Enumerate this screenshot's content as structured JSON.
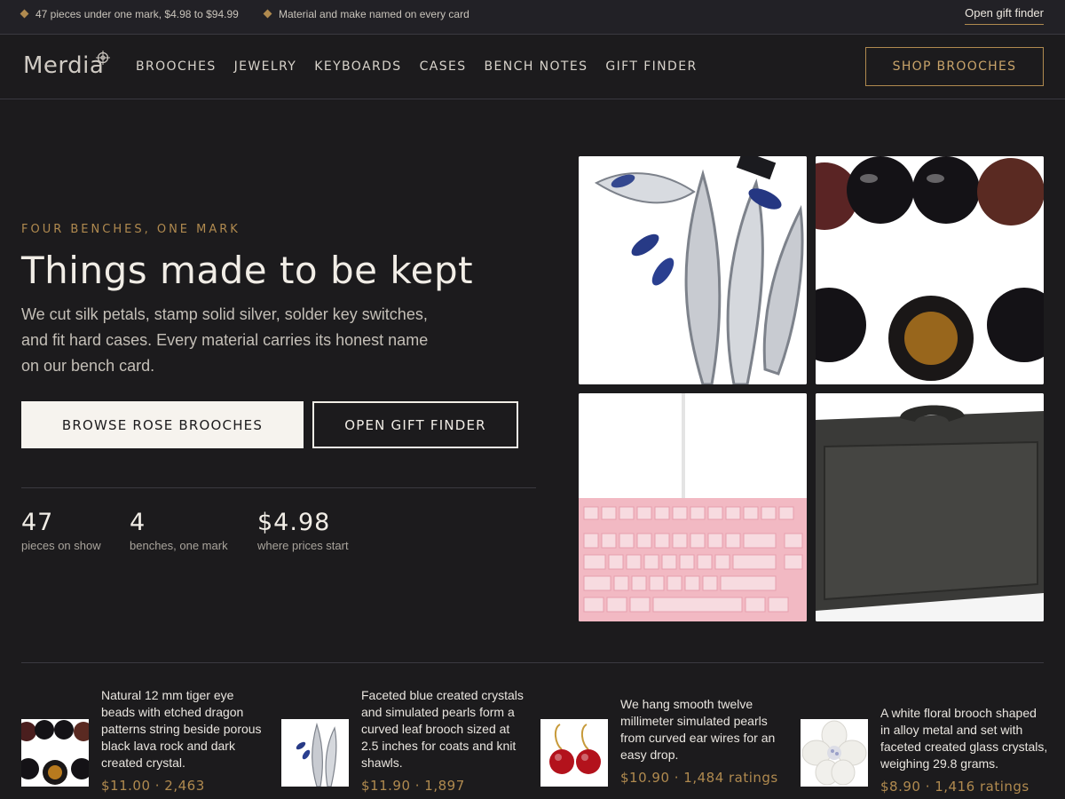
{
  "promo": {
    "items": [
      "47 pieces under one mark, $4.98 to $94.99",
      "Material and make named on every card"
    ],
    "link": "Open gift finder"
  },
  "header": {
    "logo": "Merdia",
    "nav": [
      "BROOCHES",
      "JEWELRY",
      "KEYBOARDS",
      "CASES",
      "BENCH NOTES",
      "GIFT FINDER"
    ],
    "cta": "SHOP BROOCHES"
  },
  "hero": {
    "eyebrow": "FOUR BENCHES, ONE MARK",
    "title": "Things made to be kept",
    "description": "We cut silk petals, stamp solid silver, solder key switches, and fit hard cases. Every material carries its honest name on our bench card.",
    "primary_button": "BROWSE ROSE BROOCHES",
    "secondary_button": "OPEN GIFT FINDER",
    "stats": [
      {
        "value": "47",
        "label": "pieces on show"
      },
      {
        "value": "4",
        "label": "benches, one mark"
      },
      {
        "value": "$4.98",
        "label": "where prices start"
      }
    ]
  },
  "products": [
    {
      "description": "Natural 12 mm tiger eye beads with etched dragon patterns string beside porous black lava rock and dark created crystal.",
      "meta": "$11.00 · 2,463"
    },
    {
      "description": "Faceted blue created crystals and simulated pearls form a curved leaf brooch sized at 2.5 inches for coats and knit shawls.",
      "meta": "$11.90 · 1,897"
    },
    {
      "description": "We hang smooth twelve millimeter simulated pearls from curved ear wires for an easy drop.",
      "meta": "$10.90 · 1,484 ratings"
    },
    {
      "description": "A white floral brooch shaped in alloy metal and set with faceted created glass crystals, weighing 29.8 grams.",
      "meta": "$8.90 · 1,416 ratings"
    }
  ],
  "colors": {
    "background": "#1c1b1d",
    "accent": "#b08a4f",
    "text": "#f1ede6"
  }
}
